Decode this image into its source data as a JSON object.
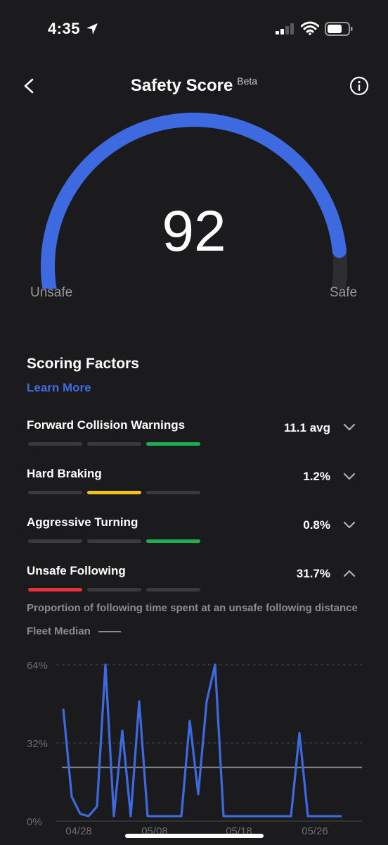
{
  "status_bar": {
    "time": "4:35"
  },
  "header": {
    "title": "Safety Score",
    "beta": "Beta"
  },
  "gauge": {
    "score": "92",
    "score_value": 92,
    "left_label": "Unsafe",
    "right_label": "Safe",
    "accent": "#3e6ae1",
    "track": "#2e2e31"
  },
  "section": {
    "title": "Scoring Factors",
    "learn_more": "Learn More"
  },
  "factors": [
    {
      "name": "Forward Collision Warnings",
      "value": "11.1 avg",
      "level": 3,
      "color": "#1fae52",
      "expanded": false
    },
    {
      "name": "Hard Braking",
      "value": "1.2%",
      "level": 2,
      "color": "#f3c01b",
      "expanded": false
    },
    {
      "name": "Aggressive Turning",
      "value": "0.8%",
      "level": 3,
      "color": "#1fae52",
      "expanded": false
    },
    {
      "name": "Unsafe Following",
      "value": "31.7%",
      "level": 1,
      "color": "#e8313a",
      "expanded": true
    }
  ],
  "detail": {
    "description": "Proportion of following time spent at an unsafe following distance",
    "fleet_median_label": "Fleet Median"
  },
  "chart_data": {
    "type": "line",
    "y_ticks": [
      "64%",
      "32%",
      "0%"
    ],
    "x_ticks": [
      "04/28",
      "05/08",
      "05/18",
      "05/26"
    ],
    "ylim": [
      0,
      64
    ],
    "fleet_median": 22,
    "series": [
      {
        "values": [
          46,
          10,
          3,
          2,
          6,
          64,
          2,
          37,
          2,
          49,
          2,
          2,
          2,
          2,
          2,
          41,
          11,
          49,
          64,
          2,
          2,
          2,
          2,
          2,
          2,
          2,
          2,
          2,
          36,
          2,
          2,
          2,
          2,
          2
        ]
      }
    ],
    "line_color": "#3e6ae1"
  }
}
